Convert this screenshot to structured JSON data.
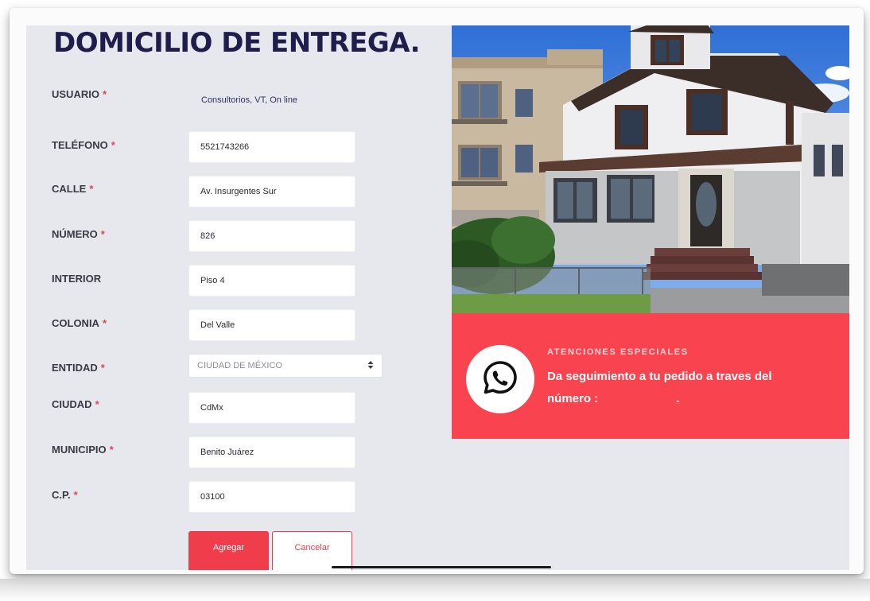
{
  "form": {
    "title": "DOMICILIO DE ENTREGA.",
    "required_mark": "*",
    "usuario": {
      "label": "USUARIO",
      "value": "Consultorios, VT, On line"
    },
    "telefono": {
      "label": "TELÉFONO",
      "value": "5521743266"
    },
    "calle": {
      "label": "CALLE",
      "value": "Av. Insurgentes Sur"
    },
    "numero": {
      "label": "NÚMERO",
      "value": "826"
    },
    "interior": {
      "label": "INTERIOR",
      "value": "Piso 4"
    },
    "colonia": {
      "label": "COLONIA",
      "value": "Del Valle"
    },
    "entidad": {
      "label": "ENTIDAD",
      "value": "CIUDAD DE MÉXICO",
      "icon": "select-arrows-icon"
    },
    "ciudad": {
      "label": "CIUDAD",
      "value": "CdMx"
    },
    "municipio": {
      "label": "MUNICIPIO",
      "value": "Benito Juárez"
    },
    "cp": {
      "label": "C.P.",
      "value": "03100"
    },
    "buttons": {
      "add": "Agregar",
      "cancel": "Cancelar"
    }
  },
  "promo": {
    "kicker": "ATENCIONES ESPECIALES",
    "text": "Da seguimiento a tu pedido a traves del",
    "text2": "número :",
    "text2_suffix": ".",
    "icon": "whatsapp-icon",
    "background": "#f9434e"
  },
  "colors": {
    "accent": "#ef3d4b",
    "title": "#1f1d4c",
    "page_bg": "#e6e8ee"
  }
}
